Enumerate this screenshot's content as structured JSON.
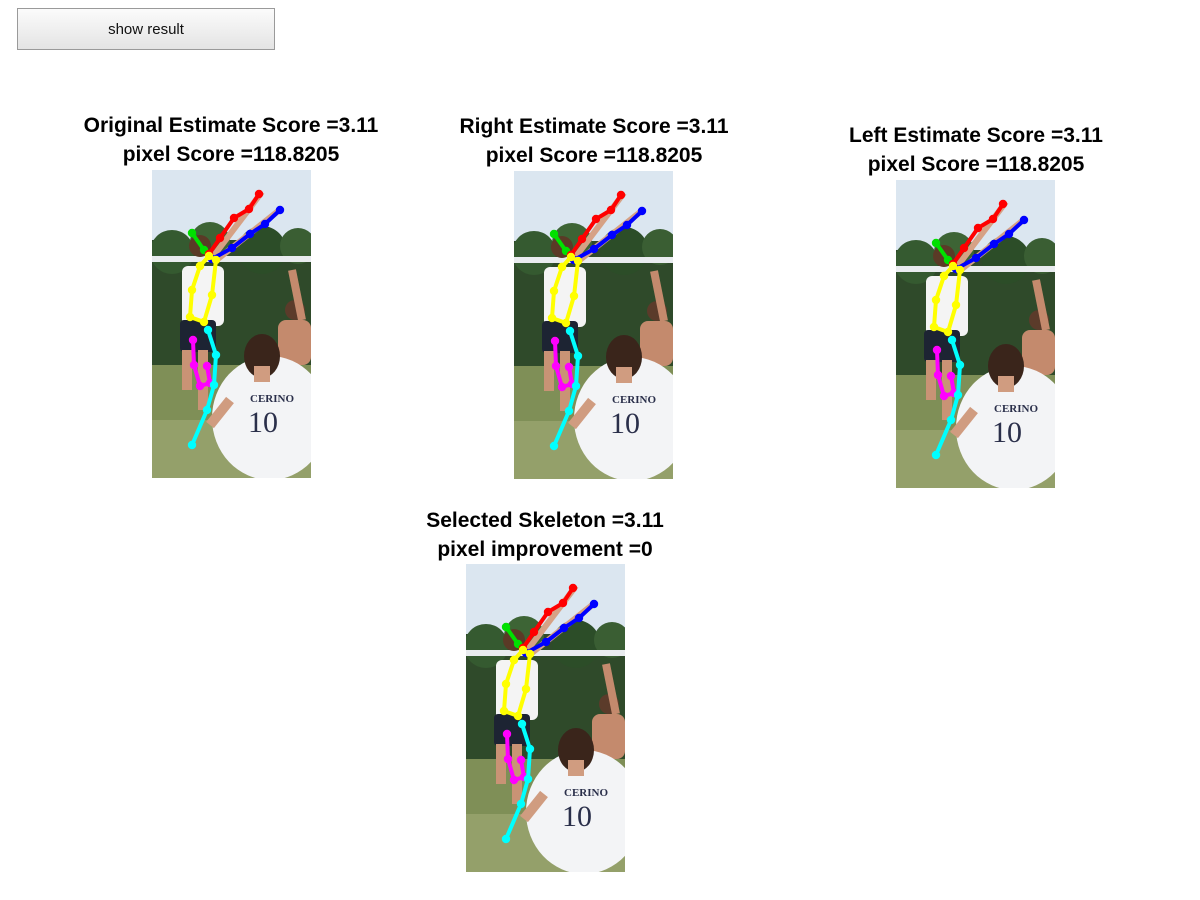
{
  "toolbar": {
    "show_result_label": "show result"
  },
  "panels": [
    {
      "title": "Original Estimate Score =3.11",
      "subtitle": "pixel Score =118.8205"
    },
    {
      "title": "Right Estimate Score =3.11",
      "subtitle": "pixel Score =118.8205"
    },
    {
      "title": "Left Estimate Score =3.11",
      "subtitle": "pixel Score =118.8205"
    },
    {
      "title": "Selected Skeleton =3.11",
      "subtitle": "pixel improvement =0"
    }
  ],
  "photo": {
    "jersey_text": "CERINO",
    "jersey_number": "10"
  },
  "colors": {
    "limb_head": "#00e000",
    "limb_right_arm": "#ff0000",
    "limb_left_arm": "#0000ff",
    "limb_torso": "#ffff00",
    "limb_right_leg": "#ff00ff",
    "limb_left_leg": "#00ffff"
  }
}
